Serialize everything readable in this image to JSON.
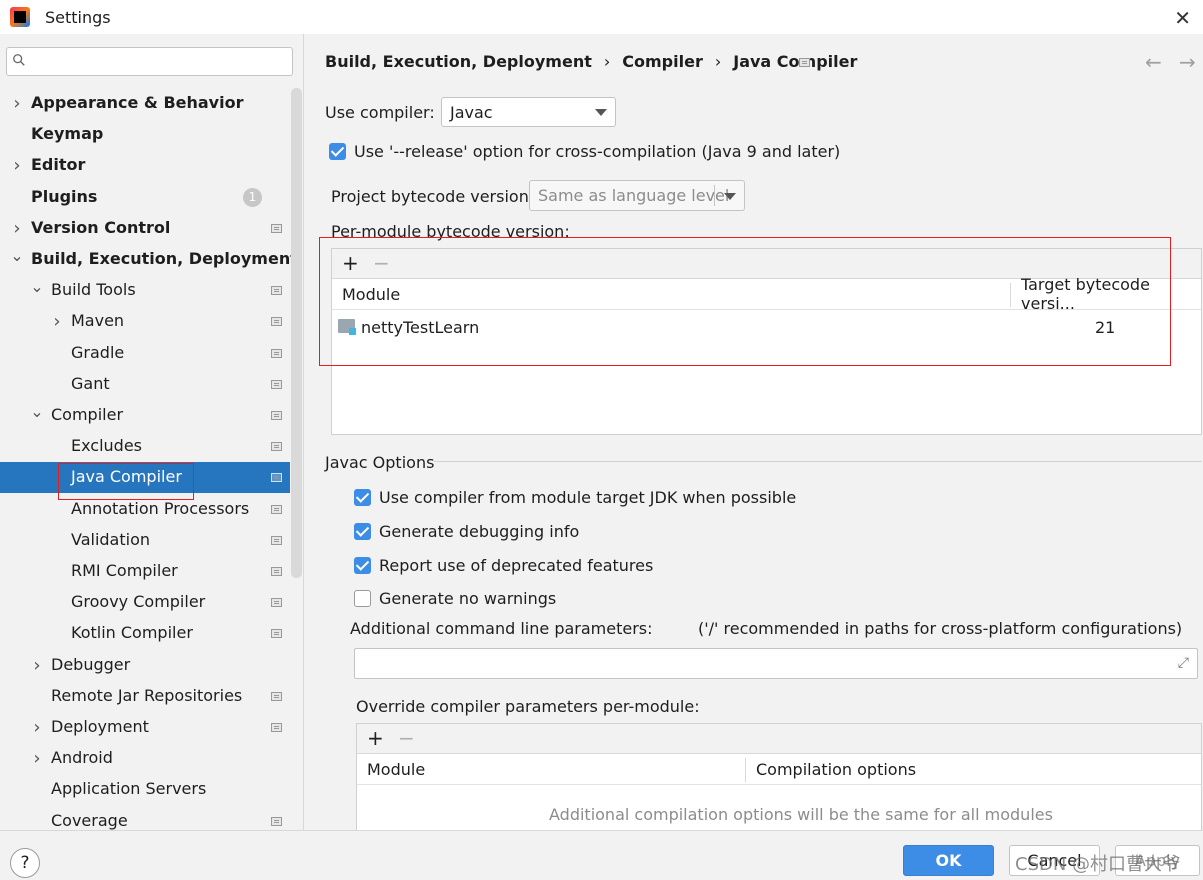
{
  "window": {
    "title": "Settings"
  },
  "search": {
    "placeholder": ""
  },
  "sidebar": {
    "items": [
      {
        "label": "Appearance & Behavior",
        "bold": true,
        "chevron": "right",
        "level": 0
      },
      {
        "label": "Keymap",
        "bold": true,
        "chevron": "none",
        "level": 0
      },
      {
        "label": "Editor",
        "bold": true,
        "chevron": "right",
        "level": 0
      },
      {
        "label": "Plugins",
        "bold": true,
        "chevron": "none",
        "level": 0,
        "badge": "1"
      },
      {
        "label": "Version Control",
        "bold": true,
        "chevron": "right",
        "level": 0,
        "project": true
      },
      {
        "label": "Build, Execution, Deployment",
        "bold": true,
        "chevron": "down",
        "level": 0
      },
      {
        "label": "Build Tools",
        "bold": false,
        "chevron": "down",
        "level": 1,
        "project": true
      },
      {
        "label": "Maven",
        "bold": false,
        "chevron": "right",
        "level": 2,
        "project": true
      },
      {
        "label": "Gradle",
        "bold": false,
        "chevron": "none",
        "level": 2,
        "project": true
      },
      {
        "label": "Gant",
        "bold": false,
        "chevron": "none",
        "level": 2,
        "project": true
      },
      {
        "label": "Compiler",
        "bold": false,
        "chevron": "down",
        "level": 1,
        "project": true
      },
      {
        "label": "Excludes",
        "bold": false,
        "chevron": "none",
        "level": 2,
        "project": true
      },
      {
        "label": "Java Compiler",
        "bold": false,
        "chevron": "none",
        "level": 2,
        "project": true,
        "selected": true
      },
      {
        "label": "Annotation Processors",
        "bold": false,
        "chevron": "none",
        "level": 2,
        "project": true
      },
      {
        "label": "Validation",
        "bold": false,
        "chevron": "none",
        "level": 2,
        "project": true
      },
      {
        "label": "RMI Compiler",
        "bold": false,
        "chevron": "none",
        "level": 2,
        "project": true
      },
      {
        "label": "Groovy Compiler",
        "bold": false,
        "chevron": "none",
        "level": 2,
        "project": true
      },
      {
        "label": "Kotlin Compiler",
        "bold": false,
        "chevron": "none",
        "level": 2,
        "project": true
      },
      {
        "label": "Debugger",
        "bold": false,
        "chevron": "right",
        "level": 1
      },
      {
        "label": "Remote Jar Repositories",
        "bold": false,
        "chevron": "none",
        "level": 1,
        "project": true
      },
      {
        "label": "Deployment",
        "bold": false,
        "chevron": "right",
        "level": 1,
        "project": true
      },
      {
        "label": "Android",
        "bold": false,
        "chevron": "right",
        "level": 1
      },
      {
        "label": "Application Servers",
        "bold": false,
        "chevron": "none",
        "level": 1
      },
      {
        "label": "Coverage",
        "bold": false,
        "chevron": "none",
        "level": 1,
        "project": true
      }
    ]
  },
  "breadcrumb": {
    "part1": "Build, Execution, Deployment",
    "part2": "Compiler",
    "part3": "Java Compiler",
    "sep": "›"
  },
  "compiler": {
    "use_compiler_label": "Use compiler:",
    "use_compiler_value": "Javac",
    "release_option_label": "Use '--release' option for cross-compilation (Java 9 and later)",
    "release_option_checked": true,
    "project_bytecode_label": "Project bytecode version:",
    "project_bytecode_value": "Same as language level",
    "per_module_label": "Per-module bytecode version:",
    "per_module_table": {
      "columns": [
        "Module",
        "Target bytecode versi..."
      ],
      "rows": [
        {
          "module": "nettyTestLearn",
          "target": "21"
        }
      ]
    }
  },
  "javac": {
    "group_title": "Javac Options",
    "options": [
      {
        "label": "Use compiler from module target JDK when possible",
        "checked": true
      },
      {
        "label": "Generate debugging info",
        "checked": true
      },
      {
        "label": "Report use of deprecated features",
        "checked": true
      },
      {
        "label": "Generate no warnings",
        "checked": false
      }
    ],
    "additional_params_label": "Additional command line parameters:",
    "additional_params_hint": "('/' recommended in paths for cross-platform configurations)",
    "additional_params_value": "",
    "override_label": "Override compiler parameters per-module:",
    "override_table": {
      "columns": [
        "Module",
        "Compilation options"
      ],
      "empty_text": "Additional compilation options will be the same for all modules"
    }
  },
  "toolbar": {
    "add": "+",
    "remove": "−"
  },
  "footer": {
    "help": "?",
    "ok": "OK",
    "cancel": "Cancel",
    "apply": "Apply",
    "watermark": "CSDN @村口曹大爷"
  }
}
